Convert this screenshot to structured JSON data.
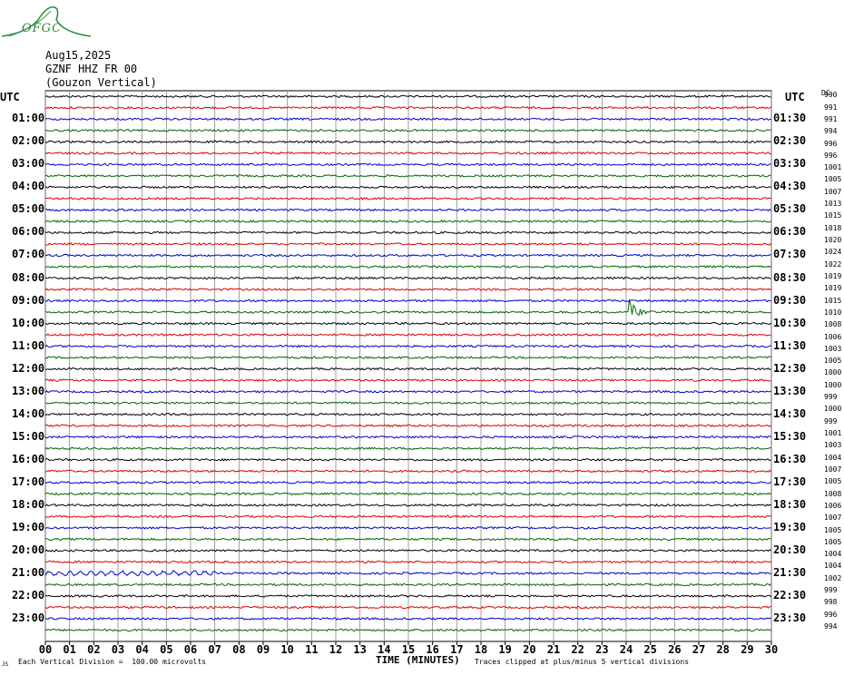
{
  "logo": {
    "text": "OFGC",
    "icon": "ofgc-mountain-logo"
  },
  "header": {
    "date": "Aug15,2025",
    "station": "GZNF HHZ FR 00",
    "location": "(Gouzon Vertical)"
  },
  "utc_left": "UTC",
  "utc_right": "UTC",
  "dc_label": "DC",
  "colors": {
    "trace_cycle": [
      "#000000",
      "#dd0000",
      "#0000cc",
      "#006600"
    ],
    "grid": "#888888"
  },
  "chart_data": {
    "type": "line",
    "title": "",
    "xlabel": "TIME (MINUTES)",
    "x_ticks": [
      "00",
      "01",
      "02",
      "03",
      "04",
      "05",
      "06",
      "07",
      "08",
      "09",
      "10",
      "11",
      "12",
      "13",
      "14",
      "15",
      "16",
      "17",
      "18",
      "19",
      "20",
      "21",
      "22",
      "23",
      "24",
      "25",
      "26",
      "27",
      "28",
      "29",
      "30"
    ],
    "xlim": [
      0,
      30
    ],
    "left_hour_labels": [
      "01:00",
      "02:00",
      "03:00",
      "04:00",
      "05:00",
      "06:00",
      "07:00",
      "08:00",
      "09:00",
      "10:00",
      "11:00",
      "12:00",
      "13:00",
      "14:00",
      "15:00",
      "16:00",
      "17:00",
      "18:00",
      "19:00",
      "20:00",
      "21:00",
      "22:00",
      "23:00"
    ],
    "right_hour_labels": [
      "01:30",
      "02:30",
      "03:30",
      "04:30",
      "05:30",
      "06:30",
      "07:30",
      "08:30",
      "09:30",
      "10:30",
      "11:30",
      "12:30",
      "13:30",
      "14:30",
      "15:30",
      "16:30",
      "17:30",
      "18:30",
      "19:30",
      "20:30",
      "21:30",
      "22:30",
      "23:30"
    ],
    "trace_offsets": [
      "990",
      "991",
      "991",
      "994",
      "996",
      "996",
      "1001",
      "1005",
      "1007",
      "1013",
      "1015",
      "1018",
      "1020",
      "1024",
      "1022",
      "1019",
      "1019",
      "1015",
      "1010",
      "1008",
      "1006",
      "1003",
      "1005",
      "1000",
      "1000",
      "999",
      "1000",
      "999",
      "1001",
      "1003",
      "1004",
      "1007",
      "1005",
      "1008",
      "1006",
      "1007",
      "1005",
      "1005",
      "1004",
      "1004",
      "1002",
      "999",
      "998",
      "996",
      "994"
    ],
    "trace_count": 48,
    "events": [
      {
        "trace_hour": "10:30",
        "minute": 24.1,
        "amplitude_divisions": 2.5,
        "description": "spike"
      }
    ],
    "grid": true
  },
  "footer": {
    "scale_note": "Each Vertical Division =  100.00 microvolts",
    "x_axis_title": "TIME (MINUTES)",
    "clip_note": "Traces clipped at plus/minus 5 vertical divisions",
    "corner_mark": "JS"
  }
}
